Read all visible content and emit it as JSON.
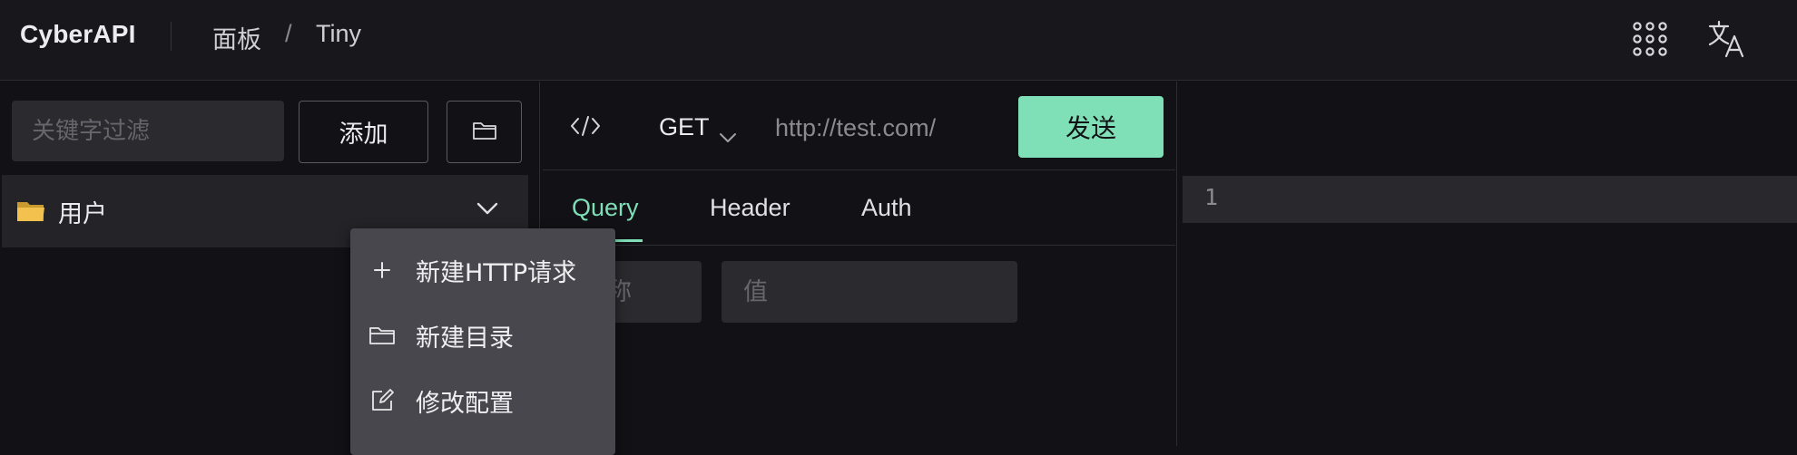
{
  "app": {
    "brand": "CyberAPI"
  },
  "breadcrumb": {
    "root": "面板",
    "separator": "/",
    "current": "Tiny"
  },
  "sidebar": {
    "filter_placeholder": "关键字过滤",
    "add_label": "添加",
    "folder": {
      "name": "用户",
      "icon": "folder-icon"
    }
  },
  "context_menu": {
    "items": [
      {
        "label": "新建HTTP请求",
        "icon": "plus-icon"
      },
      {
        "label": "新建目录",
        "icon": "folder-outline-icon"
      },
      {
        "label": "修改配置",
        "icon": "edit-icon"
      }
    ]
  },
  "request": {
    "method": "GET",
    "url_placeholder": "http://test.com/",
    "send_label": "发送",
    "tabs": [
      {
        "label": "Query",
        "active": true
      },
      {
        "label": "Header",
        "active": false
      },
      {
        "label": "Auth",
        "active": false
      }
    ],
    "query": {
      "key_placeholder": "名称",
      "value_placeholder": "值"
    }
  },
  "response": {
    "line_numbers": [
      "1"
    ]
  },
  "colors": {
    "accent": "#7fe0b8",
    "background": "#111116",
    "surface": "#2a2a2f",
    "menu": "#47474d"
  }
}
